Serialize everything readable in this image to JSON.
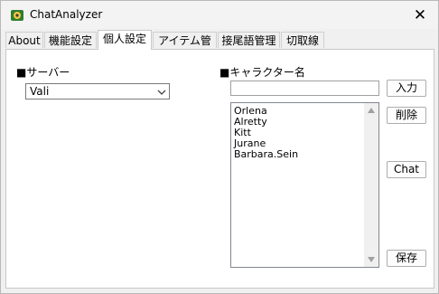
{
  "window": {
    "title": "ChatAnalyzer",
    "close_label": "✕"
  },
  "tabs": [
    {
      "label": "About",
      "active": false
    },
    {
      "label": "機能設定",
      "active": false
    },
    {
      "label": "個人設定",
      "active": true
    },
    {
      "label": "アイテム管理",
      "active": false
    },
    {
      "label": "接尾語管理",
      "active": false
    },
    {
      "label": "切取線",
      "active": false
    }
  ],
  "server": {
    "label": "■サーバー",
    "selected": "Vali"
  },
  "character": {
    "label": "■キャラクター名",
    "input_value": "",
    "names": [
      "Orlena",
      "Alretty",
      "Kitt",
      "Jurane",
      "Barbara.Sein"
    ]
  },
  "buttons": {
    "input": "入力",
    "delete": "削除",
    "chat": "Chat",
    "save": "保存"
  },
  "icons": {
    "app": "chat-analyzer-app-icon",
    "dropdown": "chevron-down-icon",
    "scroll_up": "scroll-up-arrow-icon",
    "scroll_down": "scroll-down-arrow-icon"
  }
}
